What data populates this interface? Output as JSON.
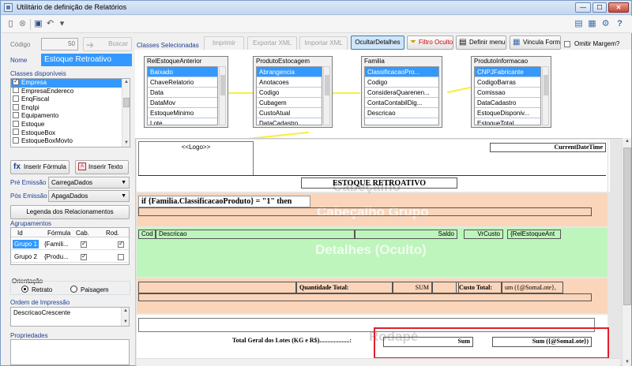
{
  "window": {
    "title": "Utilitário de definição de Relatórios",
    "controls": {
      "minimize": "—",
      "maximize": "☐",
      "close": "✕"
    }
  },
  "toolbar": {
    "icons": [
      "new-icon",
      "delete-icon",
      "save-icon",
      "undo-icon",
      "more-icon"
    ],
    "right_icons": [
      "dock-icon",
      "layout-icon",
      "settings-icon",
      "help-icon"
    ],
    "glyphs": {
      "new": "▯",
      "delete": "⊗",
      "save": "▣",
      "undo": "↶",
      "more": "▾",
      "dock": "▤",
      "layout": "▦",
      "settings": "⚙",
      "help": "?"
    }
  },
  "left": {
    "codigo_label": "Código",
    "codigo_value": "50",
    "buscar_label": "Buscar",
    "nome_label": "Nome",
    "nome_value": "Estoque Retroativo",
    "classes_label": "Classes disponíveis",
    "classes": [
      {
        "label": "Empresa",
        "checked": true,
        "selected": true
      },
      {
        "label": "EmpresaEndereco",
        "checked": false
      },
      {
        "label": "EnqFiscal",
        "checked": false
      },
      {
        "label": "EnqIpi",
        "checked": false
      },
      {
        "label": "Equipamento",
        "checked": false
      },
      {
        "label": "Estoque",
        "checked": false
      },
      {
        "label": "EstoqueBox",
        "checked": false
      },
      {
        "label": "EstoqueBoxMovto",
        "checked": false
      }
    ],
    "inserir_formula": "Inserir Fórmula",
    "inserir_texto": "Inserir Texto",
    "pre_emissao_label": "Pré Emissão",
    "pre_emissao_value": "CarregaDados",
    "pos_emissao_label": "Pós Emissão",
    "pos_emissao_value": "ApagaDados",
    "legenda_button": "Legenda dos Relacionamentos",
    "agrupamentos_label": "Agrupamentos",
    "agrup_headers": [
      "Id",
      "Fórmula",
      "Cab.",
      "Rod."
    ],
    "agrup_rows": [
      {
        "id": "Grupo 1",
        "formula": "{Famili...",
        "cab": true,
        "rod": true,
        "selected": true
      },
      {
        "id": "Grupo 2",
        "formula": "{Produ...",
        "cab": true,
        "rod": false,
        "selected": false
      }
    ],
    "orientacao_label": "Orientação",
    "retrato_label": "Retrato",
    "paisagem_label": "Paisagem",
    "orientacao_selected": "retrato",
    "ordem_label": "Ordem de Impressão",
    "ordem_value": "DescricaoCrescente",
    "propriedades_label": "Propriedades"
  },
  "top_actions": {
    "classes_selecionadas": "Classes Selecionadas",
    "imprimir": "Imprimir",
    "exportar_xml": "Exportar XML",
    "importar_xml": "Importar XML",
    "ocultar_detalhes": "OcultarDetalhes",
    "filtro_oculto": "Filtro Oculto",
    "definir_menu": "Definir menu",
    "vincula_form": "Vincula Form",
    "omitir_margem": "Omitir Margem?"
  },
  "tables": [
    {
      "name": "RelEstoqueAnterior",
      "fields": [
        "Baixado",
        "ChaveRelatorio",
        "Data",
        "DataMov",
        "EstoqueMinimo",
        "Lote"
      ]
    },
    {
      "name": "ProdutoEstocagem",
      "fields": [
        "Abrangencia",
        "Anotacoes",
        "Codigo",
        "Cubagem",
        "CustoAtual",
        "DataCadastro"
      ]
    },
    {
      "name": "Familia",
      "fields": [
        "ClassificacaoPro...",
        "Codigo",
        "ConsideraQuarenen...",
        "ContaContabilDig...",
        "Descricao"
      ]
    },
    {
      "name": "ProdutoInformacao",
      "fields": [
        "CNPJFabricante",
        "CodigoBarras",
        "Comissao",
        "DataCadastro",
        "EstoqueDisponiv...",
        "EstoqueTotal"
      ]
    }
  ],
  "report": {
    "logo": "<<Logo>>",
    "current_date_time": "CurrentDateTime",
    "title": "ESTOQUE RETROATIVO",
    "cabecalho_ghost": "Cabeçalho",
    "group_header_formula": "if {Familia.ClassificacaoProduto} = \"1\" then",
    "group_ghost": "Cabeçalho Grupo",
    "detail_fields": [
      "Cod",
      "Descricao",
      "Saldo",
      "VrCusto",
      "{RelEstoqueAnt"
    ],
    "detalhes_ghost": "Detalhes (Oculto)",
    "quantidade_total": "Quantidade Total:",
    "sum_label": "SUM",
    "custo_total": "Custo Total:",
    "custo_formula": "um ({@SomaLote},",
    "total_geral": "Total Geral dos Lotes (KG e R$)...................:",
    "rodape_ghost": "Rodapé",
    "sum2": "Sum",
    "sum_soma_lote": "Sum ({@SomaLote})"
  },
  "colors": {
    "band_orange": "#fbd5ba",
    "band_green": "#bef5bc",
    "relation_line": "#f7ef3a",
    "selection": "#3399ff",
    "highlight_box": "#e0202a"
  }
}
